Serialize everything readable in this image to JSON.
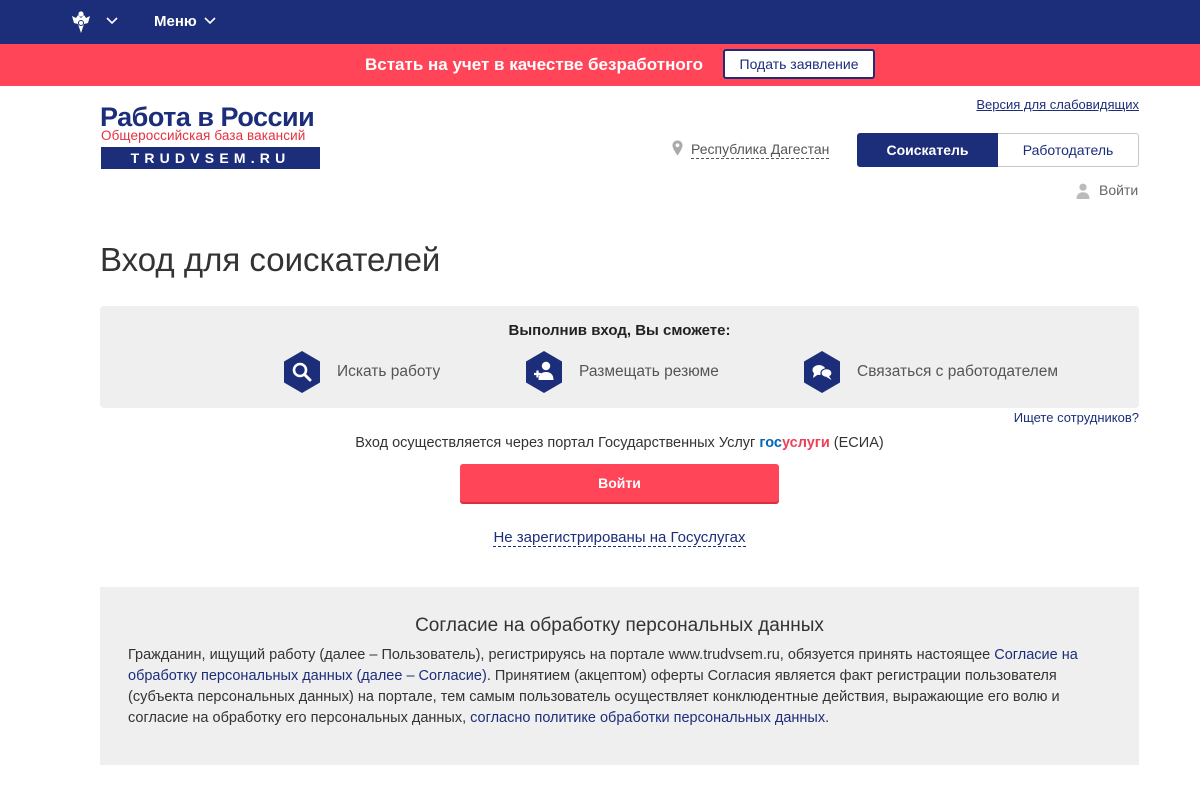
{
  "topbar": {
    "emblem_icon": "coat-of-arms-icon",
    "menu_label": "Меню"
  },
  "banner": {
    "text": "Встать на учет в качестве безработного",
    "button_label": "Подать заявление"
  },
  "logo": {
    "title": "Работа в России",
    "subtitle": "Общероссийская база вакансий",
    "domain": "TRUDVSEM.RU"
  },
  "header": {
    "accessible_version": "Версия для слабовидящих",
    "region": "Республика Дагестан",
    "roles": [
      "Соискатель",
      "Работодатель"
    ],
    "active_role": "Соискатель",
    "login": "Войти"
  },
  "page": {
    "title": "Вход для соискателей"
  },
  "benefits": {
    "title": "Выполнив вход, Вы сможете:",
    "items": [
      {
        "label": "Искать работу",
        "icon": "search-icon"
      },
      {
        "label": "Размещать резюме",
        "icon": "add-user-icon"
      },
      {
        "label": "Связаться с работодателем",
        "icon": "chat-icon"
      }
    ]
  },
  "links": {
    "employers": "Ищете сотрудников?",
    "not_registered": "Не зарегистрированы на Госуслугах"
  },
  "portal": {
    "text_before": "Вход осуществляется через портал Государственных Услуг",
    "gos_part1": "гос",
    "gos_part2": "услуги",
    "text_after": "(ЕСИА)"
  },
  "login_button": "Войти",
  "consent": {
    "title": "Согласие на обработку персональных данных",
    "text1": "Гражданин, ищущий работу (далее – Пользователь), регистрируясь на портале www.trudvsem.ru, обязуется принять настоящее ",
    "link1": "Согласие на обработку персональных данных (далее – Согласие)",
    "text2": ". Принятием (акцептом) оферты Согласия является факт регистрации пользователя (субъекта персональных данных) на портале, тем самым пользователь осуществляет конклюдентные действия, выражающие его волю и согласие на обработку его персональных данных, ",
    "link2": "согласно политике обработки персональных данных",
    "text3": "."
  },
  "colors": {
    "navy": "#1c2e7a",
    "red": "#ff4557",
    "panel": "#efefef"
  }
}
